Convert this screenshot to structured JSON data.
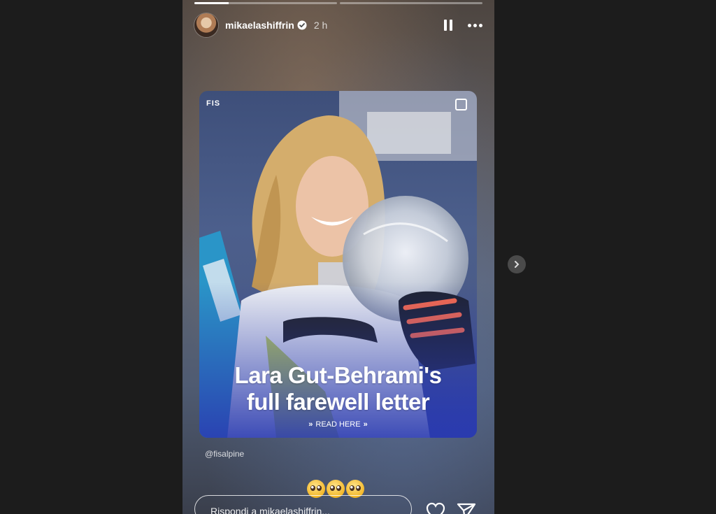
{
  "story": {
    "progress": [
      0.24,
      0
    ],
    "username": "mikaelashiffrin",
    "time": "2 h",
    "mention": "@fisalpine",
    "reply_placeholder": "Rispondi a mikaelashiffrin...",
    "emojis": [
      "pleading-face",
      "pleading-face",
      "pleading-face"
    ]
  },
  "card": {
    "logo_text": "FIS",
    "headline_line1": "Lara Gut-Behrami's",
    "headline_line2": "full farewell letter",
    "cta": "READ HERE"
  },
  "colors": {
    "page_bg": "#1c1c1c",
    "card_gradient_bottom": "#2c3fa6",
    "next_button": "#4a4a4a"
  },
  "icons": [
    "verified-badge-icon",
    "pause-icon",
    "more-icon",
    "heart-icon",
    "send-icon",
    "chevron-right-icon"
  ]
}
